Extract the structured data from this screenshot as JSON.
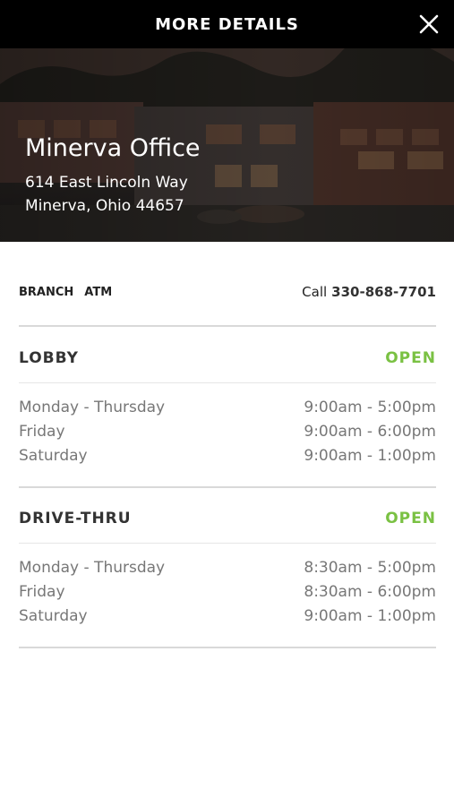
{
  "header": {
    "title": "MORE DETAILS",
    "close_icon": "close-icon"
  },
  "location": {
    "name": "Minerva Office",
    "address_line1": "614 East Lincoln Way",
    "address_line2": "Minerva, Ohio 44657"
  },
  "services": {
    "tags": [
      "BRANCH",
      "ATM"
    ],
    "call_label": "Call",
    "phone": "330-868-7701"
  },
  "sections": [
    {
      "title": "LOBBY",
      "status": "OPEN",
      "hours": [
        {
          "days": "Monday - Thursday",
          "time": "9:00am - 5:00pm"
        },
        {
          "days": "Friday",
          "time": "9:00am - 6:00pm"
        },
        {
          "days": "Saturday",
          "time": "9:00am - 1:00pm"
        }
      ]
    },
    {
      "title": "DRIVE-THRU",
      "status": "OPEN",
      "hours": [
        {
          "days": "Monday - Thursday",
          "time": "8:30am - 5:00pm"
        },
        {
          "days": "Friday",
          "time": "8:30am - 6:00pm"
        },
        {
          "days": "Saturday",
          "time": "9:00am - 1:00pm"
        }
      ]
    }
  ],
  "colors": {
    "header_bg": "#000000",
    "status_open": "#7ac143",
    "divider": "#d9d9d9"
  }
}
